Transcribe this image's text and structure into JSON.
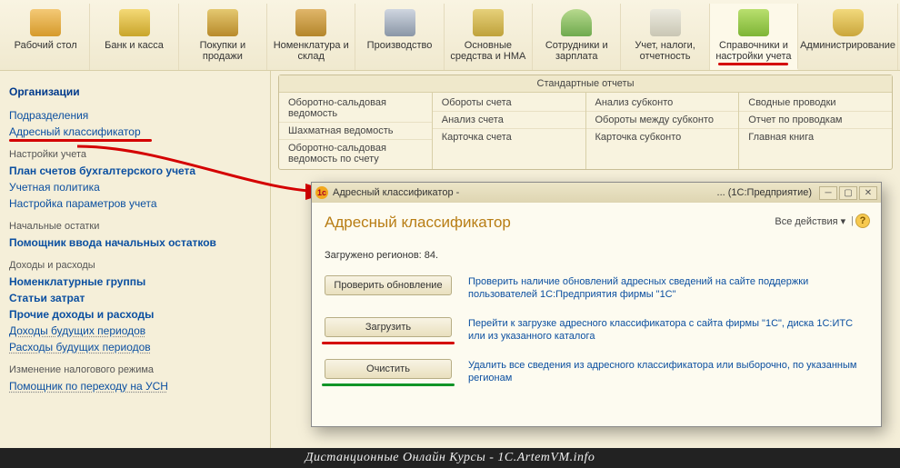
{
  "toolbar": {
    "items": [
      {
        "label": "Рабочий стол"
      },
      {
        "label": "Банк и касса"
      },
      {
        "label": "Покупки и продажи"
      },
      {
        "label": "Номенклатура и склад"
      },
      {
        "label": "Производство"
      },
      {
        "label": "Основные средства и НМА"
      },
      {
        "label": "Сотрудники и зарплата"
      },
      {
        "label": "Учет, налоги, отчетность"
      },
      {
        "label": "Справочники и настройки учета"
      },
      {
        "label": "Администрирование"
      }
    ]
  },
  "sidebar": {
    "organizations": "Организации",
    "subdivisions": "Подразделения",
    "address_classifier": "Адресный классификатор",
    "settings_head": "Настройки учета",
    "chart_accounts": "План счетов бухгалтерского учета",
    "acc_policy": "Учетная политика",
    "params": "Настройка параметров учета",
    "init_head": "Начальные остатки",
    "init_helper": "Помощник ввода начальных остатков",
    "income_head": "Доходы и расходы",
    "nom_groups": "Номенклатурные группы",
    "cost_items": "Статьи затрат",
    "other_income": "Прочие доходы и расходы",
    "future_income": "Доходы будущих периодов",
    "future_expenses": "Расходы будущих периодов",
    "tax_head": "Изменение налогового режима",
    "usn_helper": "Помощник по переходу на УСН"
  },
  "reports": {
    "title": "Стандартные отчеты",
    "col1": [
      "Оборотно-сальдовая ведомость",
      "Шахматная ведомость",
      "Оборотно-сальдовая ведомость по счету"
    ],
    "col2": [
      "Обороты счета",
      "Анализ счета",
      "Карточка счета"
    ],
    "col3": [
      "Анализ субконто",
      "Обороты между субконто",
      "Карточка субконто"
    ],
    "col4": [
      "Сводные проводки",
      "Отчет по проводкам",
      "Главная книга"
    ]
  },
  "dialog": {
    "title_left": "Адресный классификатор -",
    "title_right": "... (1С:Предприятие)",
    "heading": "Адресный классификатор",
    "all_actions": "Все действия ▾",
    "status": "Загружено регионов: 84.",
    "btn_check": "Проверить обновление",
    "desc_check": "Проверить наличие обновлений адресных сведений на сайте поддержки пользователей 1С:Предприятия фирмы \"1C\"",
    "btn_load": "Загрузить",
    "desc_load": "Перейти к загрузке адресного классификатора с сайта фирмы \"1C\", диска 1С:ИТС или из указанного каталога",
    "btn_clear": "Очистить",
    "desc_clear": "Удалить все сведения из адресного классификатора или выборочно, по указанным регионам"
  },
  "footer": "Дистанционные Онлайн Курсы - 1C.ArtemVM.info"
}
